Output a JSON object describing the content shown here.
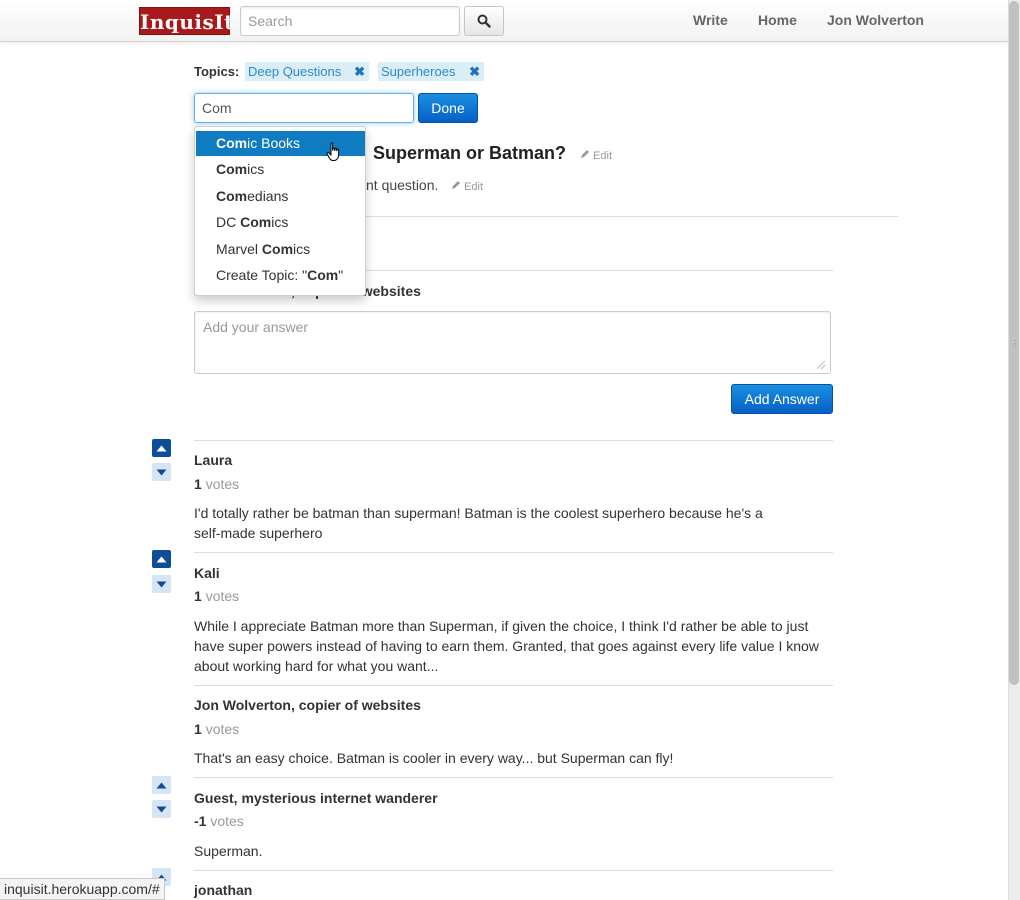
{
  "navbar": {
    "brand": "InquisIt",
    "search_placeholder": "Search",
    "links": {
      "write": "Write",
      "home": "Home",
      "user": "Jon Wolverton"
    }
  },
  "topics": {
    "label": "Topics:",
    "tags": [
      "Deep Questions",
      "Superheroes"
    ],
    "input_value": "Com",
    "done_label": "Done"
  },
  "dropdown": {
    "query": "Com",
    "items": [
      {
        "bold": "Com",
        "rest": "ic Books",
        "pre": ""
      },
      {
        "bold": "Com",
        "rest": "ics",
        "pre": ""
      },
      {
        "bold": "Com",
        "rest": "edians",
        "pre": ""
      },
      {
        "pre": "DC ",
        "bold": "Com",
        "rest": "ics"
      },
      {
        "pre": "Marvel ",
        "bold": "Com",
        "rest": "ics"
      }
    ],
    "create": {
      "pre": "Create Topic: \"",
      "bold": "Com",
      "rest": "\""
    }
  },
  "question": {
    "title_visible": "Superman or Batman?",
    "body_visible": "nt question.",
    "edit_label": "Edit"
  },
  "compose": {
    "author_visible": "Jon Wolverton, copier of websites",
    "placeholder": "Add your answer",
    "submit_label": "Add Answer"
  },
  "votes_word": "votes",
  "answers": [
    {
      "name": "Laura",
      "votes": "1",
      "text": "I'd totally rather be batman than superman! Batman is the coolest superhero because he's a self-made superhero"
    },
    {
      "name": "Kali",
      "votes": "1",
      "text": "While I appreciate Batman more than Superman, if given the choice, I think I'd rather be able to just have super powers instead of having to earn them. Granted, that goes against every life value I know about working hard for what you want..."
    },
    {
      "name": "Jon Wolverton, copier of websites",
      "votes": "1",
      "text": "That's an easy choice. Batman is cooler in every way... but Superman can fly!"
    },
    {
      "name": "Guest, mysterious internet wanderer",
      "votes": "-1",
      "text": "Superman."
    },
    {
      "name": "jonathan",
      "votes": "",
      "text": ""
    }
  ],
  "status_url": "inquisit.herokuapp.com/#",
  "colors": {
    "brand": "#a8191b",
    "primary": "#0760c7",
    "tag_bg": "#dbeef8",
    "tag_text": "#2b8acb",
    "dropdown_active": "#0f7bc0",
    "vote_dark": "#0e4e96",
    "vote_light": "#d5e5f4"
  },
  "icons": {
    "search": "magnifier-icon",
    "tag_remove": "close-icon",
    "edit": "pencil-icon",
    "vote_up": "arrow-up-icon",
    "vote_down": "arrow-down-icon",
    "cursor": "hand-pointer-icon"
  }
}
